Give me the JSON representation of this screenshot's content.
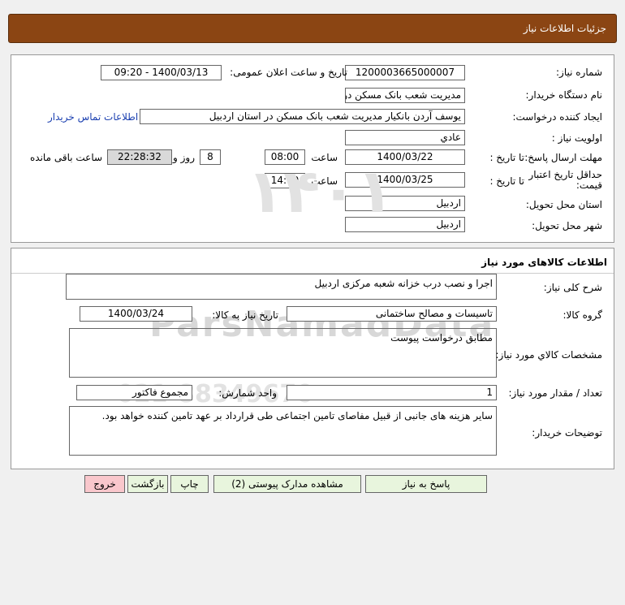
{
  "window": {
    "title": "جزئیات اطلاعات نیاز"
  },
  "details": {
    "need_number_label": "شماره نیاز:",
    "need_number": "1200003665000007",
    "announce_label": "تاریخ و ساعت اعلان عمومی:",
    "announce_value": "1400/03/13 - 09:20",
    "buyer_org_label": "نام دستگاه خریدار:",
    "buyer_org": "مدیریت شعب بانک مسکن در استان اردبیل",
    "creator_label": "ایجاد کننده درخواست:",
    "creator": "یوسف  آردن بانکیار مدیریت شعب بانک مسکن در استان اردبیل",
    "contact_link": "اطلاعات تماس خریدار",
    "priority_label": "اولویت نیاز :",
    "priority": "عادي",
    "deadline_label": "مهلت ارسال پاسخ:",
    "to_date_label": "تا تاریخ :",
    "deadline_date": "1400/03/22",
    "time_label": "ساعت",
    "deadline_time": "08:00",
    "days_value": "8",
    "days_label": "روز و",
    "countdown": "22:28:32",
    "remaining_label": "ساعت باقی مانده",
    "validity_label": "حداقل تاریخ اعتبار قیمت:",
    "validity_to_label": "تا تاریخ :",
    "validity_date": "1400/03/25",
    "validity_time_label": "ساعت",
    "validity_time": "14:00",
    "province_label": "استان محل تحویل:",
    "province": "اردبیل",
    "city_label": "شهر محل تحویل:",
    "city": "اردبیل"
  },
  "goods": {
    "section_title": "اطلاعات کالاهای مورد نیاز",
    "desc_label": "شرح کلی نیاز:",
    "desc": "اجرا و نصب درب خزانه شعبه مرکزی اردبیل",
    "group_label": "گروه کالا:",
    "group": "تاسیسات و مصالح ساختمانی",
    "need_date_label": "تاریخ نیاز به کالا:",
    "need_date": "1400/03/24",
    "spec_label": "مشخصات کالاي مورد نیاز:",
    "spec": "مطابق درخواست پیوست",
    "qty_label": "تعداد / مقدار مورد نیاز:",
    "qty": "1",
    "unit_label": "واحد شمارش:",
    "unit": "مجموع فاکتور",
    "notes_label": "توضیحات خریدار:",
    "notes": "سایر هزینه های جانبی از قبیل مفاصای تامین اجتماعی طی قرارداد بر عهد تامین کننده خواهد بود."
  },
  "buttons": {
    "reply": "پاسخ به نیاز",
    "attachments": "مشاهده مدارک پیوستی (2)",
    "print": "چاپ",
    "back": "بازگشت",
    "exit": "خروج"
  }
}
